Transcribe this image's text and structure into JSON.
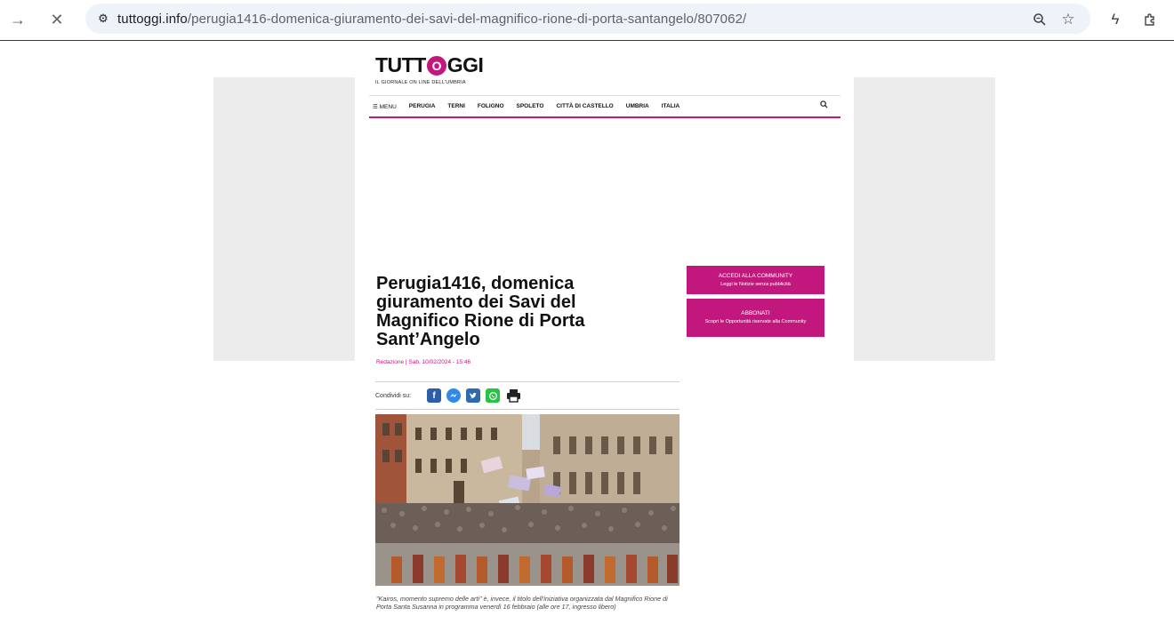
{
  "browser": {
    "url_host": "tuttoggi.info",
    "url_path": "/perugia1416-domenica-giuramento-dei-savi-del-magnifico-rione-di-porta-santangelo/807062/",
    "icons": [
      "forward-icon",
      "close-icon",
      "site-info-icon",
      "zoom-icon",
      "star-icon",
      "bolt-icon",
      "extensions-icon"
    ]
  },
  "site": {
    "logo_pre": "TUTT",
    "logo_o": "O",
    "logo_post": "GGI",
    "tagline": "IL GIORNALE ON LINE DELL'UMBRIA",
    "accent_color": "#c2187e",
    "menu": {
      "menu_label": "☰ MENU",
      "items": [
        "PERUGIA",
        "TERNI",
        "FOLIGNO",
        "SPOLETO",
        "CITTÀ DI CASTELLO",
        "UMBRIA",
        "ITALIA"
      ]
    }
  },
  "sidebar": {
    "cta1_title": "ACCEDI ALLA COMMUNITY",
    "cta1_sub": "Leggi le Notizie senza pubblicità",
    "cta2_title": "ABBONATI",
    "cta2_sub": "Scopri le Opportunità riservate alla Community"
  },
  "article": {
    "title": "Perugia1416, domenica giuramento dei Savi del Magnifico Rione di Porta Sant’Angelo",
    "byline": "Redazione | Sab, 10/02/2024 - 15:46",
    "share_label": "Condividi su:",
    "caption": "\"Kairos, momento supremo delle arti\" è, invece, il titolo dell'iniziativa organizzata dal Magnifico Rione di Porta Santa Susanna in programma venerdì 16 febbraio (alle ore 17, ingresso libero)"
  }
}
